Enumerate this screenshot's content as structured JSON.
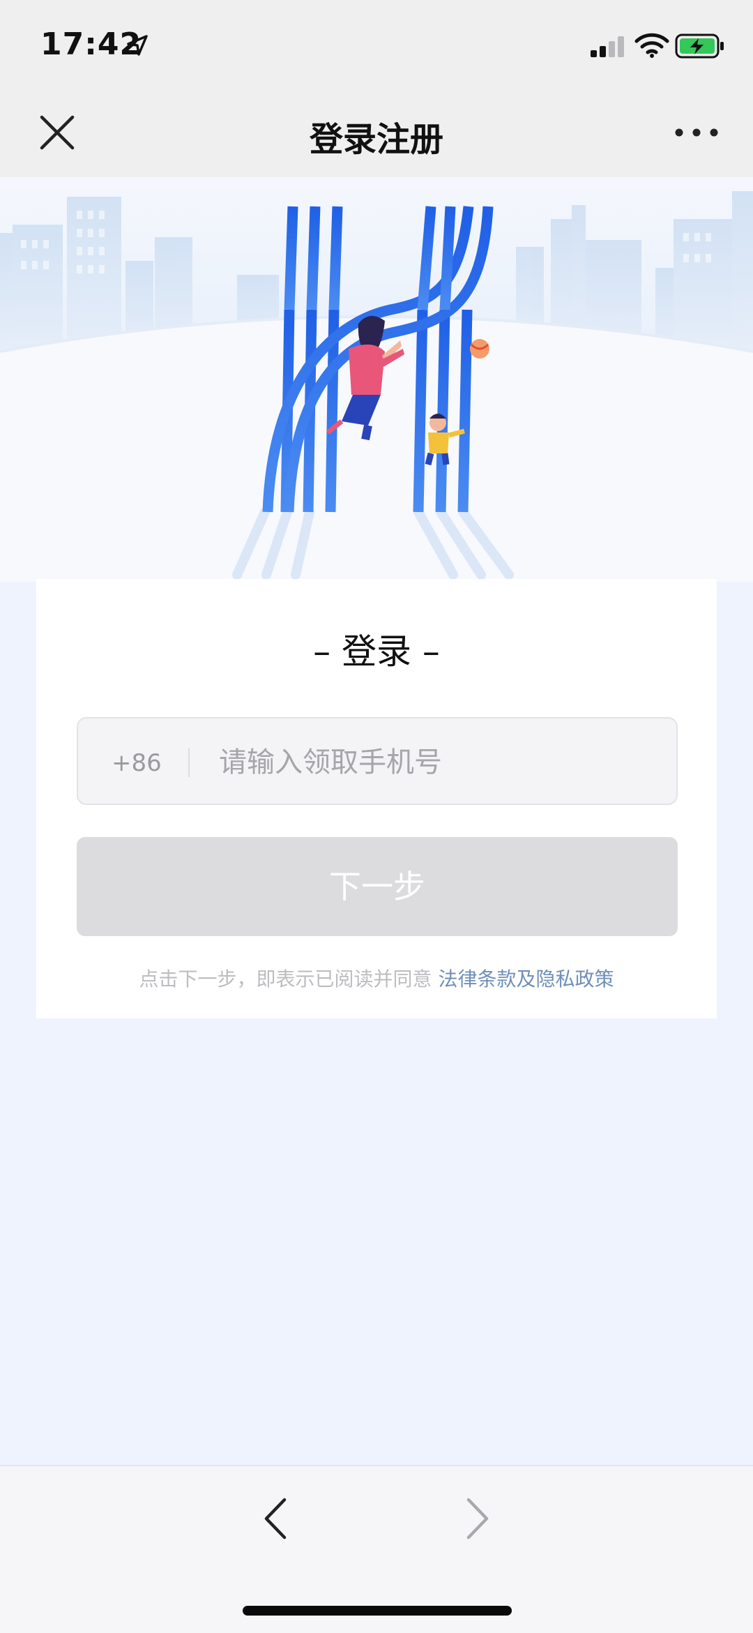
{
  "status_bar": {
    "time": "17:42",
    "icons": [
      "location-arrow-icon",
      "cellular-signal-icon",
      "wifi-icon",
      "battery-charging-icon"
    ],
    "battery_color": "#34c759"
  },
  "navbar": {
    "title": "登录注册",
    "close_icon": "close-icon",
    "more_icon": "more-icon"
  },
  "hero": {
    "illustration": "blue-striped-H-logo-with-mother-and-child-playing-ball",
    "logo_color": "#2f6ee8"
  },
  "login_card": {
    "title": "– 登录 –",
    "country_code": "+86",
    "phone_placeholder": "请输入领取手机号",
    "phone_value": "",
    "next_button": "下一步",
    "agreement_prefix": "点击下一步，即表示已阅读并同意",
    "agreement_link": "法律条款及隐私政策"
  },
  "bottom_bar": {
    "back_icon": "chevron-left-icon",
    "forward_icon": "chevron-right-icon"
  },
  "colors": {
    "page_background": "#eef3fd",
    "accent": "#2f6ee8",
    "link": "#6f8fb8",
    "disabled_button": "#dcdcde"
  }
}
